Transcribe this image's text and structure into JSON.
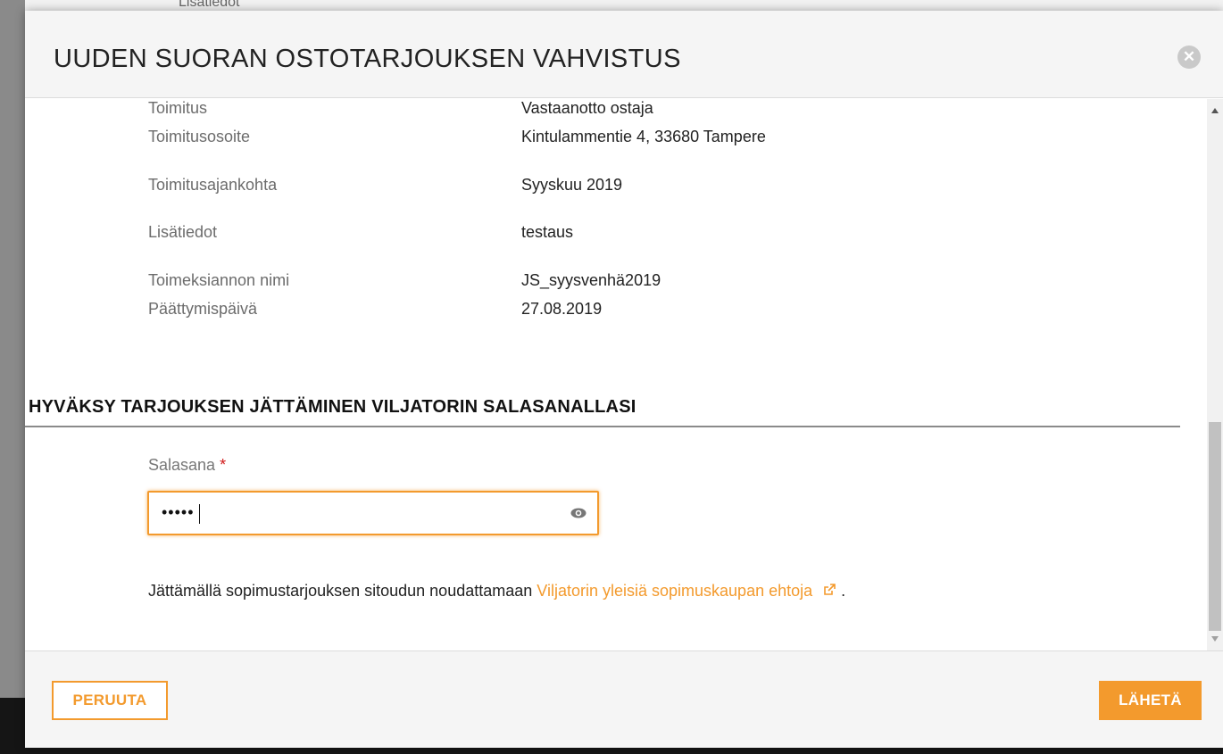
{
  "background": {
    "partial_text": "Lisätiedot"
  },
  "modal": {
    "title": "UUDEN SUORAN OSTOTARJOUKSEN VAHVISTUS",
    "close_icon": "close-icon",
    "details": [
      {
        "label": "Toimitus",
        "value": "Vastaanotto ostaja"
      },
      {
        "label": "Toimitusosoite",
        "value": "Kintulammentie 4, 33680 Tampere"
      },
      {
        "label": "Toimitusajankohta",
        "value": "Syyskuu 2019"
      },
      {
        "label": "Lisätiedot",
        "value": "testaus"
      },
      {
        "label": "Toimeksiannon nimi",
        "value": "JS_syysvenhä2019"
      },
      {
        "label": "Päättymispäivä",
        "value": "27.08.2019"
      }
    ],
    "section_heading": "HYVÄKSY TARJOUKSEN JÄTTÄMINEN VILJATORIN SALASANALLASI",
    "password": {
      "label": "Salasana",
      "required_mark": "*",
      "value": "•••••",
      "toggle_icon": "eye-icon"
    },
    "terms": {
      "text_before": "Jättämällä sopimustarjouksen sitoudun noudattamaan",
      "link_text": "Viljatorin yleisiä sopimuskaupan ehtoja",
      "link_icon": "external-link-icon",
      "text_after": "."
    },
    "footer": {
      "cancel_label": "PERUUTA",
      "send_label": "LÄHETÄ"
    }
  },
  "colors": {
    "accent": "#f39a2d",
    "required": "#d01818",
    "header_bg": "#f5f5f5"
  }
}
